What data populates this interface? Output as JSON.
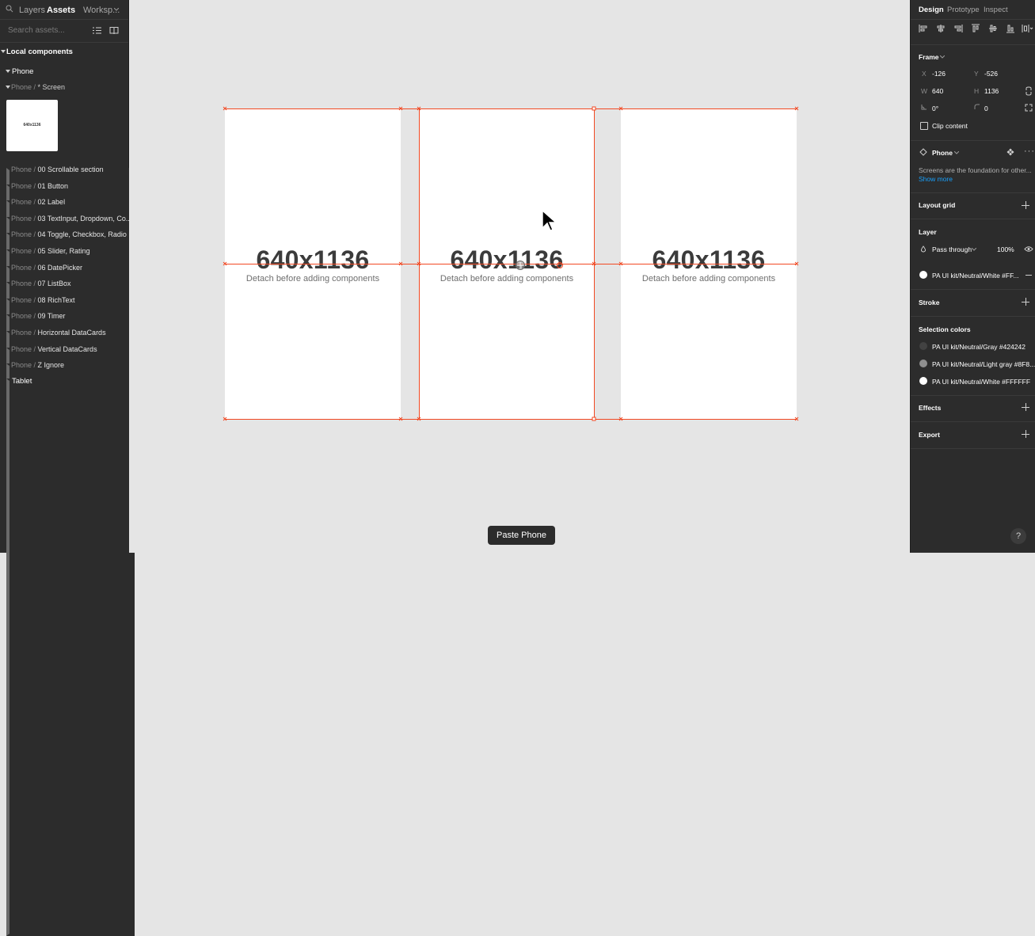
{
  "left_panel": {
    "tabs": [
      "Layers",
      "Assets",
      "Worksp..."
    ],
    "search_placeholder": "Search assets...",
    "section": "Local components",
    "group": "Phone",
    "screen_item": {
      "prefix": "Phone / ",
      "name": "* Screen"
    },
    "thumbnail_label": "640x1136",
    "items": [
      {
        "prefix": "Phone / ",
        "name": "00 Scrollable section"
      },
      {
        "prefix": "Phone / ",
        "name": "01 Button"
      },
      {
        "prefix": "Phone / ",
        "name": "02 Label"
      },
      {
        "prefix": "Phone / ",
        "name": "03 TextInput, Dropdown, Co..."
      },
      {
        "prefix": "Phone / ",
        "name": "04 Toggle, Checkbox, Radio"
      },
      {
        "prefix": "Phone / ",
        "name": "05 Slider, Rating"
      },
      {
        "prefix": "Phone / ",
        "name": "06 DatePicker"
      },
      {
        "prefix": "Phone / ",
        "name": "07 ListBox"
      },
      {
        "prefix": "Phone / ",
        "name": "08 RichText"
      },
      {
        "prefix": "Phone / ",
        "name": "09 Timer"
      },
      {
        "prefix": "Phone / ",
        "name": "Horizontal DataCards"
      },
      {
        "prefix": "Phone / ",
        "name": "Vertical DataCards"
      },
      {
        "prefix": "Phone / ",
        "name": "Z Ignore"
      }
    ],
    "tablet_group": "Tablet"
  },
  "canvas": {
    "frames": [
      {
        "size": "640x1136",
        "note": "Detach before adding components"
      },
      {
        "size": "640x1136",
        "note": "Detach before adding components"
      },
      {
        "size": "640x1136",
        "note": "Detach before adding components"
      }
    ],
    "toast": "Paste Phone",
    "selection_color": "#f24822"
  },
  "right_panel": {
    "tabs": [
      "Design",
      "Prototype",
      "Inspect"
    ],
    "frame_label": "Frame",
    "x_label": "X",
    "x_value": "-126",
    "y_label": "Y",
    "y_value": "-526",
    "w_label": "W",
    "w_value": "640",
    "h_label": "H",
    "h_value": "1136",
    "rotation": "0°",
    "radius": "0",
    "clip_content": "Clip content",
    "component_name": "Phone",
    "description": "Screens are the foundation for other...",
    "show_more": "Show more",
    "layout_grid": "Layout grid",
    "layer": "Layer",
    "blend_mode": "Pass through",
    "opacity": "100%",
    "fill_name": "PA UI kit/Neutral/White #FF...",
    "stroke": "Stroke",
    "selection_colors": "Selection colors",
    "colors": [
      {
        "name": "PA UI kit/Neutral/Gray #424242",
        "hex": "#424242"
      },
      {
        "name": "PA UI kit/Neutral/Light gray #8F8...",
        "hex": "#8f8f8f"
      },
      {
        "name": "PA UI kit/Neutral/White #FFFFFF",
        "hex": "#ffffff"
      }
    ],
    "effects": "Effects",
    "export": "Export",
    "help": "?"
  }
}
